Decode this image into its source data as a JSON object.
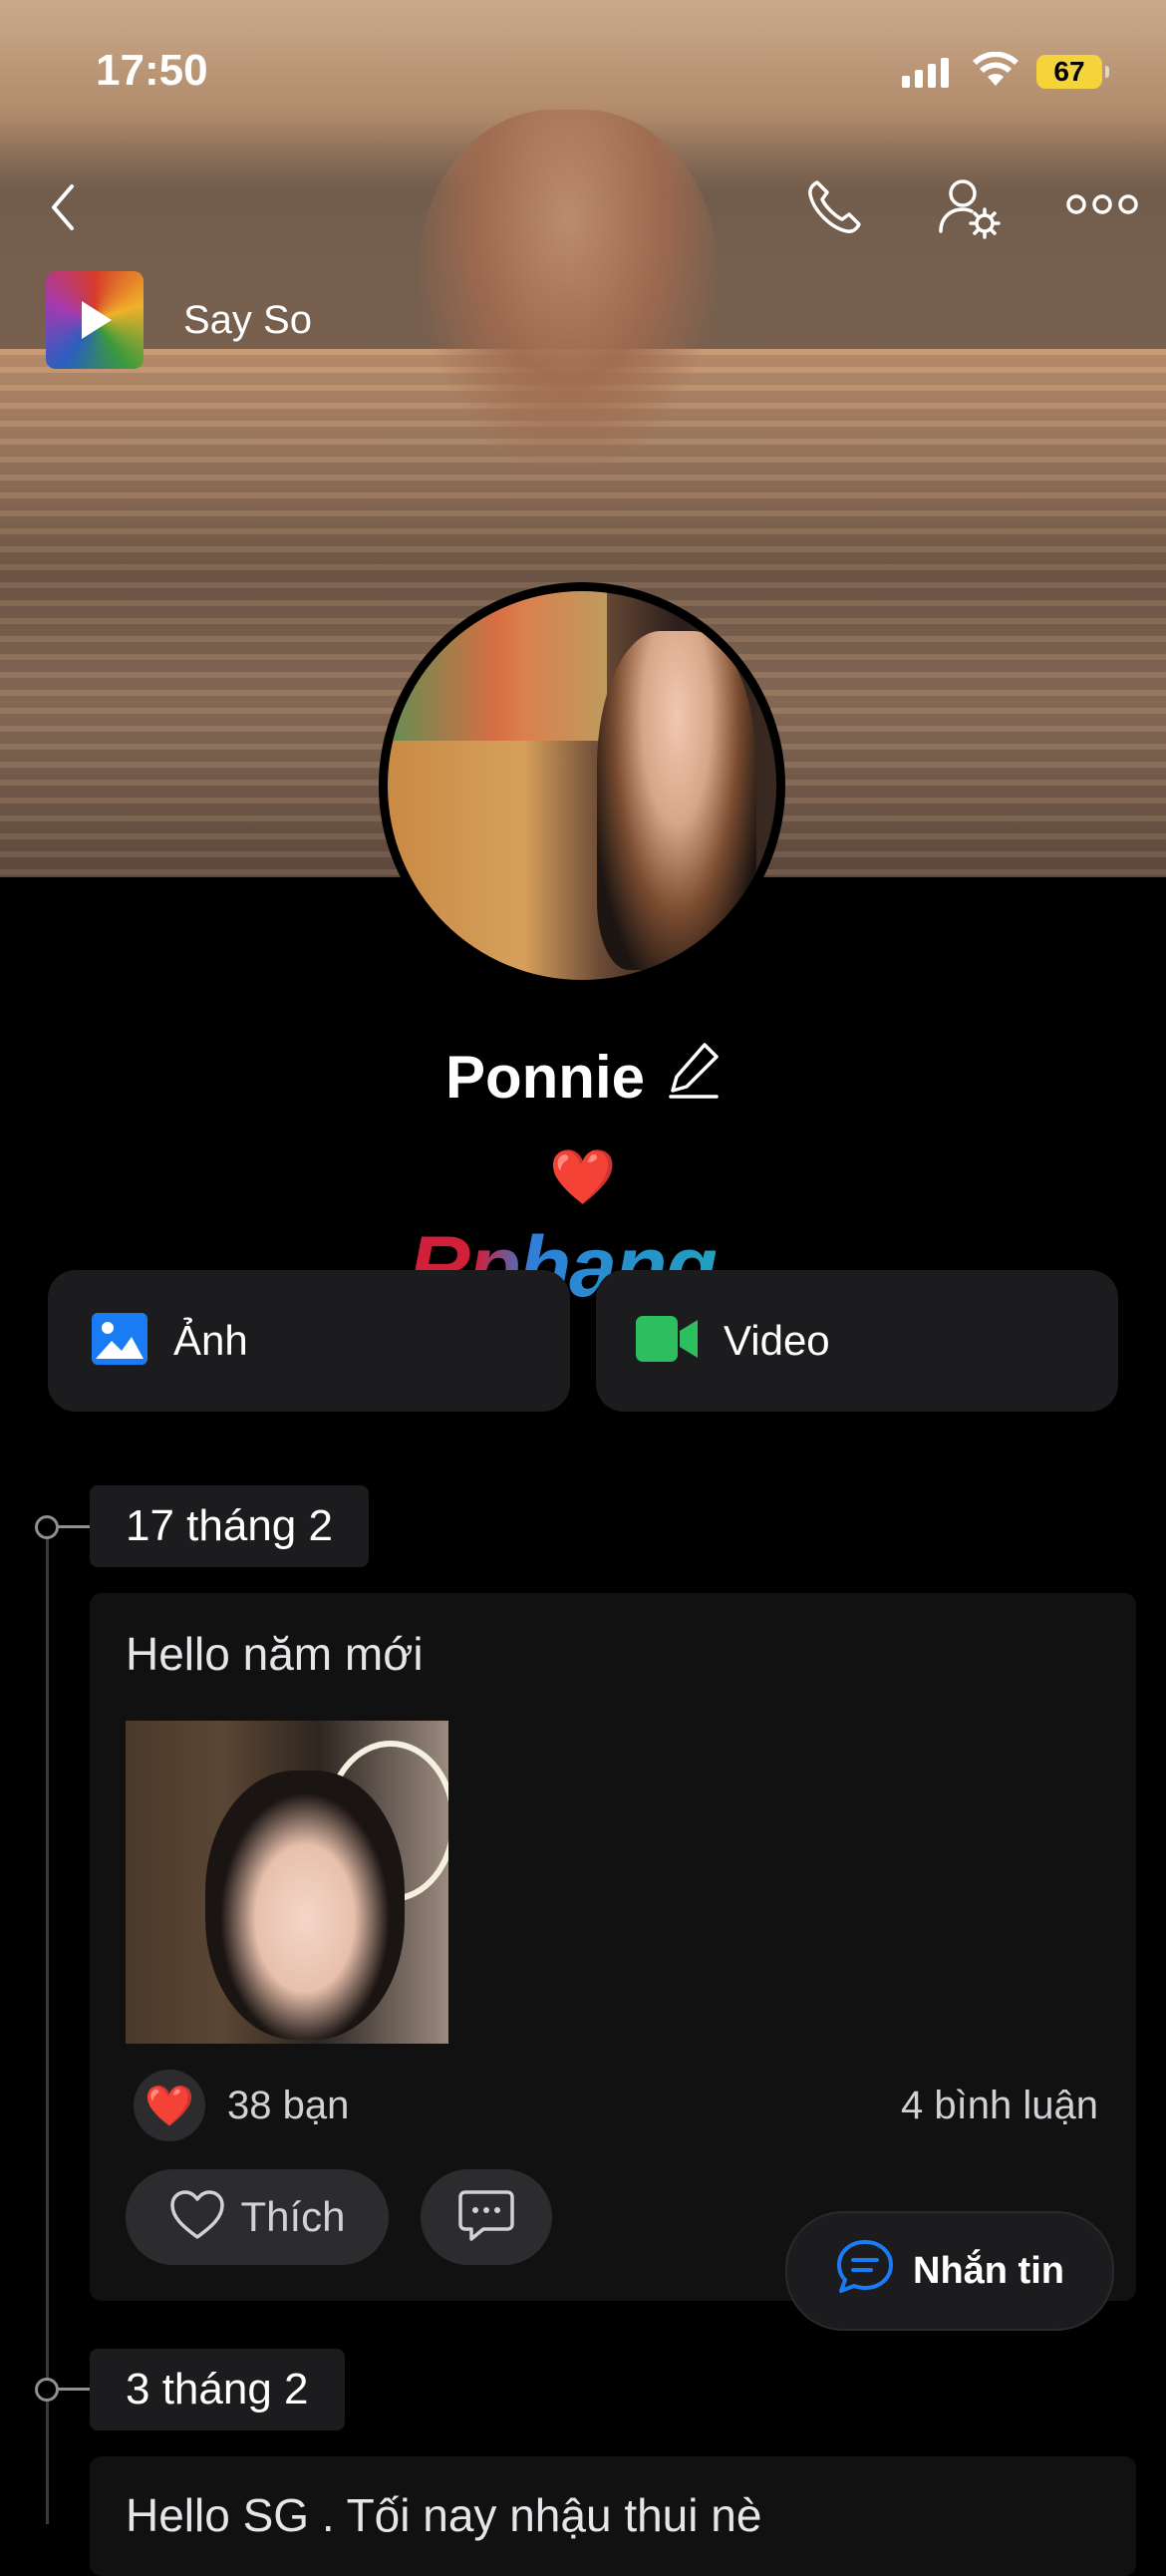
{
  "status_bar": {
    "time": "17:50",
    "battery": "67"
  },
  "cover": {
    "music": {
      "title": "Say So"
    }
  },
  "profile": {
    "name": "Ponnie",
    "bio": "❤️"
  },
  "watermark": "Rphang",
  "media_tabs": [
    {
      "label": "Ảnh",
      "icon": "image-icon",
      "color": "#1a7cf5"
    },
    {
      "label": "Video",
      "icon": "video-icon",
      "color": "#2dbe60"
    }
  ],
  "timeline": [
    {
      "date": "17 tháng 2",
      "text": "Hello năm mới",
      "reaction_icon": "❤️",
      "likes": "38 bạn",
      "comments": "4 bình luận",
      "like_label": "Thích"
    },
    {
      "date": "3 tháng 2",
      "text": "Hello SG . Tối nay nhậu thui nè"
    }
  ],
  "fab": {
    "label": "Nhắn tin"
  },
  "colors": {
    "accent": "#1a7cf5",
    "background": "#000000",
    "card": "#1c1c1e",
    "battery": "#f5d33b"
  }
}
